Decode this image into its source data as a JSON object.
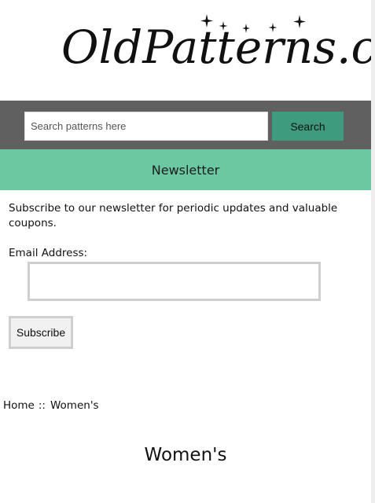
{
  "logo": {
    "text": "OldPatterns.com"
  },
  "search": {
    "placeholder": "Search patterns here",
    "value": "",
    "button_label": "Search"
  },
  "newsletter": {
    "title": "Newsletter",
    "intro": "Subscribe to our newsletter for periodic updates and valuable coupons.",
    "email_label": "Email Address:",
    "email_value": "",
    "subscribe_label": "Subscribe"
  },
  "breadcrumb": {
    "home": "Home",
    "separator": "::",
    "current": "Women's"
  },
  "page": {
    "title": "Women's"
  },
  "colors": {
    "search_bar_bg": "#606060",
    "search_button_bg": "#3f9b7d",
    "newsletter_bar_bg": "#6cc8a1",
    "input_border": "#cfcfcf"
  }
}
